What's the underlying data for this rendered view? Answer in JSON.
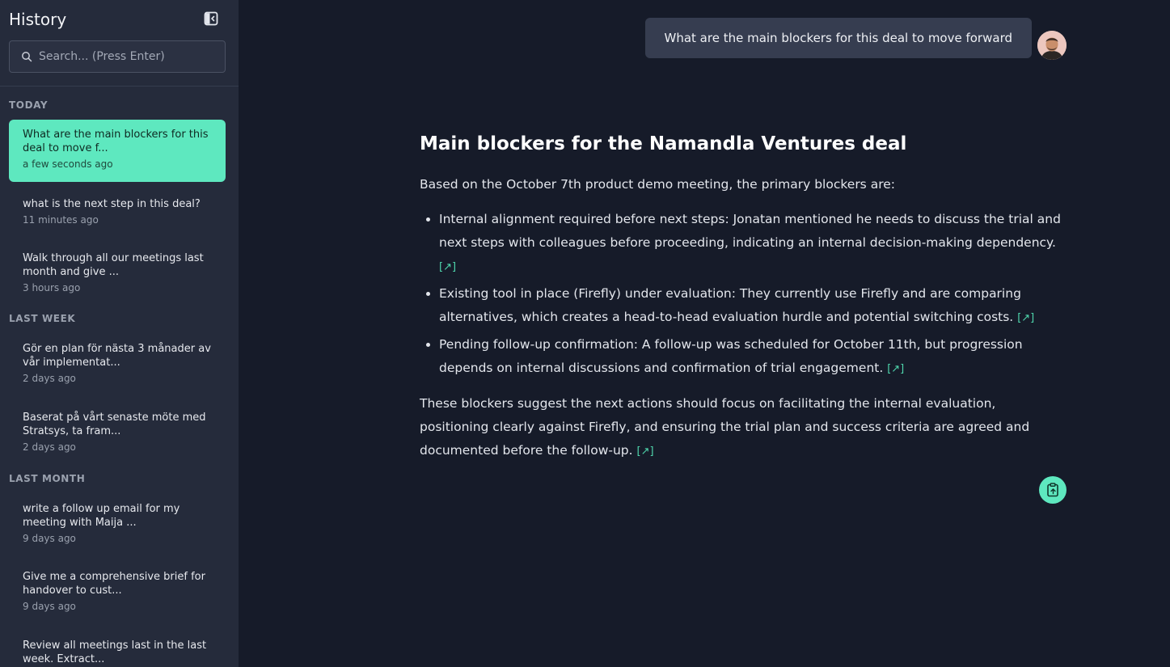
{
  "sidebar": {
    "title": "History",
    "search_placeholder": "Search... (Press Enter)",
    "groups": [
      {
        "label": "TODAY",
        "items": [
          {
            "question": "What are the main blockers for this deal to move f...",
            "time": "a few seconds ago",
            "active": true
          },
          {
            "question": "what is the next step in this deal?",
            "time": "11 minutes ago"
          },
          {
            "question": "Walk through all our meetings last month and give ...",
            "time": "3 hours ago"
          }
        ]
      },
      {
        "label": "LAST WEEK",
        "items": [
          {
            "question": "Gör en plan för nästa 3 månader av vår implementat...",
            "time": "2 days ago"
          },
          {
            "question": "Baserat på vårt senaste möte med Stratsys, ta fram...",
            "time": "2 days ago"
          }
        ]
      },
      {
        "label": "LAST MONTH",
        "items": [
          {
            "question": "write a follow up email for my meeting with Maija ...",
            "time": "9 days ago"
          },
          {
            "question": "Give me a comprehensive brief for handover to cust...",
            "time": "9 days ago"
          },
          {
            "question": "Review all meetings last in the last week. Extract...",
            "time": ""
          }
        ]
      }
    ]
  },
  "chat": {
    "user_message": "What are the main blockers for this deal to move forward",
    "answer": {
      "heading": "Main blockers for the Namandla Ventures deal",
      "intro": "Based on the October 7th product demo meeting, the primary blockers are:",
      "bullets": [
        "Internal alignment required before next steps: Jonatan mentioned he needs to discuss the trial and next steps with colleagues before proceeding, indicating an internal decision-making dependency.",
        "Existing tool in place (Firefly) under evaluation: They currently use Firefly and are comparing alternatives, which creates a head-to-head evaluation hurdle and potential switching costs.",
        "Pending follow-up confirmation: A follow-up was scheduled for October 11th, but progression depends on internal discussions and confirmation of trial engagement."
      ],
      "outro": "These blockers suggest the next actions should focus on facilitating the internal evaluation, positioning clearly against Firefly, and ensuring the trial plan and success criteria are agreed and documented before the follow-up.",
      "source_link_label": "[↗]"
    }
  },
  "colors": {
    "accent": "#5ee8bf",
    "sidebar_bg": "#252b3b",
    "main_bg": "#161b29",
    "bubble_bg": "#363d50",
    "link": "#4fd7ad"
  },
  "icons": {
    "collapse": "sidebar-collapse-icon",
    "search": "search-icon",
    "copy": "clipboard-copy-icon",
    "source": "external-link-icon"
  }
}
